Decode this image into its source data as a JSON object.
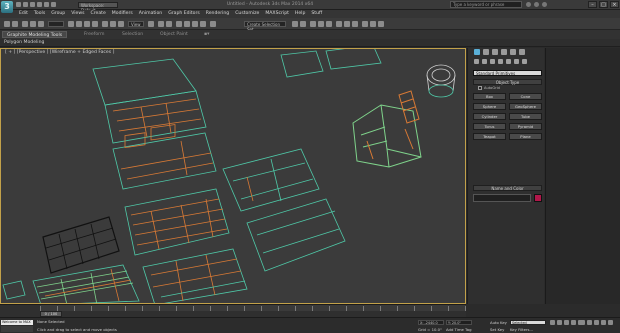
{
  "app": {
    "logo": "3",
    "workspace_label": "Workspace: Default",
    "window_title": "Untitled - Autodesk 3ds Max 2014 x64",
    "search_placeholder": "Type a keyword or phrase"
  },
  "menu": [
    "Edit",
    "Tools",
    "Group",
    "Views",
    "Create",
    "Modifiers",
    "Animation",
    "Graph Editors",
    "Rendering",
    "Customize",
    "MAXScript",
    "Help",
    "Stuff"
  ],
  "toolbar": {
    "selection_set_placeholder": "Create Selection Set",
    "view_dropdown": "View"
  },
  "ribbon": {
    "tabs": [
      "Graphite Modeling Tools",
      "Freeform",
      "Selection",
      "Object Paint"
    ],
    "active_tab": 0,
    "sub_label": "Polygon Modeling"
  },
  "viewport": {
    "label": "[ + ] [Perspective ] [Wireframe + Edged Faces ]"
  },
  "command_panel": {
    "category_dropdown": "Standard Primitives",
    "object_type_header": "Object Type",
    "autogrid_label": "AutoGrid",
    "buttons": [
      "Box",
      "Cone",
      "Sphere",
      "GeoSphere",
      "Cylinder",
      "Tube",
      "Torus",
      "Pyramid",
      "Teapot",
      "Plane"
    ],
    "name_color_header": "Name and Color",
    "swatch_color": "#b1174a"
  },
  "timeline": {
    "slider_label": "0 / 100"
  },
  "status": {
    "maxscript": "Welcome to MAX",
    "line1": "None Selected",
    "line2": "Click and drag to select and move objects",
    "x_value": "X: -2440.0",
    "y_value": "Y: 20.0\"",
    "grid": "Grid = 10.0\"",
    "add_time_tag": "Add Time Tag",
    "auto_key": "Auto Key",
    "set_key": "Set Key",
    "selected": "Selected",
    "key_filters": "Key Filters..."
  },
  "colors": {
    "accent_wire_green": "#4fc9a8",
    "accent_wire_orange": "#d97a35",
    "viewport_border": "#c2a14a"
  }
}
